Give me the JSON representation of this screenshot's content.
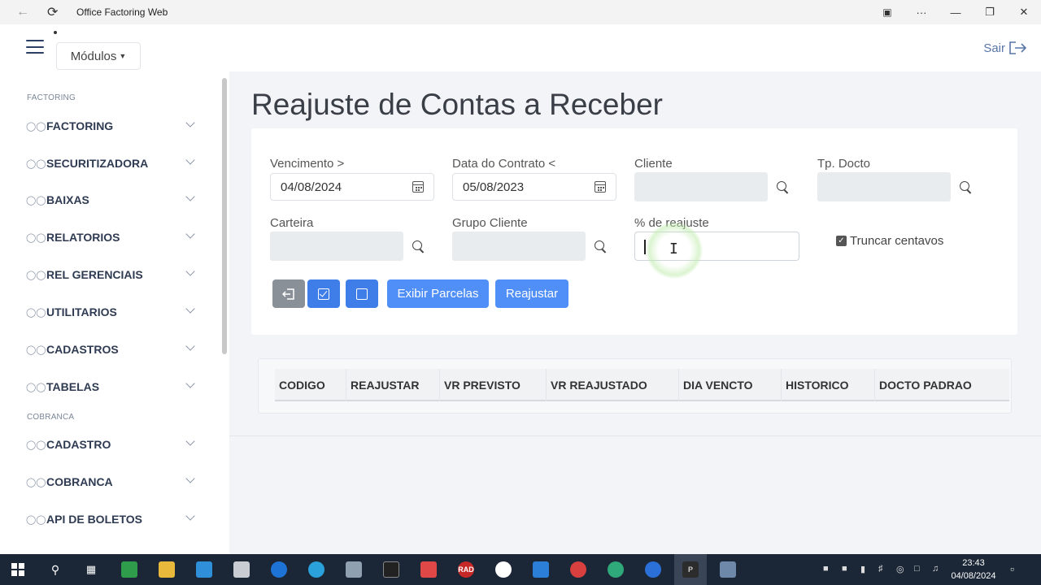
{
  "window": {
    "title": "Office Factoring Web",
    "back_icon": "arrow-left-icon",
    "refresh_icon": "refresh-icon",
    "controls": [
      "app-icon",
      "more-icon",
      "minimize-icon",
      "maximize-icon",
      "close-icon"
    ]
  },
  "header": {
    "modules_label": "Módulos",
    "logout_label": "Sair"
  },
  "sidebar": {
    "sections": [
      {
        "caption": "FACTORING",
        "items": [
          "FACTORING",
          "SECURITIZADORA",
          "BAIXAS",
          "RELATORIOS",
          "REL GERENCIAIS",
          "UTILITARIOS",
          "CADASTROS",
          "TABELAS"
        ]
      },
      {
        "caption": "COBRANCA",
        "items": [
          "CADASTRO",
          "COBRANCA",
          "API DE BOLETOS"
        ]
      }
    ]
  },
  "main": {
    "title": "Reajuste de Contas a Receber",
    "filters": {
      "vencimento_label": "Vencimento >",
      "vencimento_value": "04/08/2024",
      "data_contrato_label": "Data do Contrato <",
      "data_contrato_value": "05/08/2023",
      "cliente_label": "Cliente",
      "tp_docto_label": "Tp. Docto",
      "carteira_label": "Carteira",
      "grupo_cliente_label": "Grupo Cliente",
      "reajuste_label": "% de reajuste",
      "reajuste_value": "",
      "truncar_label": "Truncar centavos",
      "truncar_checked": true
    },
    "buttons": {
      "exibir": "Exibir Parcelas",
      "reajustar": "Reajustar"
    },
    "table": {
      "columns": [
        "CODIGO",
        "REAJUSTAR",
        "VR PREVISTO",
        "VR REAJUSTADO",
        "DIA VENCTO",
        "HISTORICO",
        "DOCTO PADRAO"
      ],
      "rows": []
    }
  },
  "taskbar": {
    "badge_rad": "RAD",
    "badge_p": "P",
    "time": "23:43",
    "date": "04/08/2024"
  },
  "colors": {
    "primary": "#4f8ff7",
    "secondary": "#8a9098",
    "sidebar_text": "#2f3b52",
    "background": "#f2f4f8"
  }
}
